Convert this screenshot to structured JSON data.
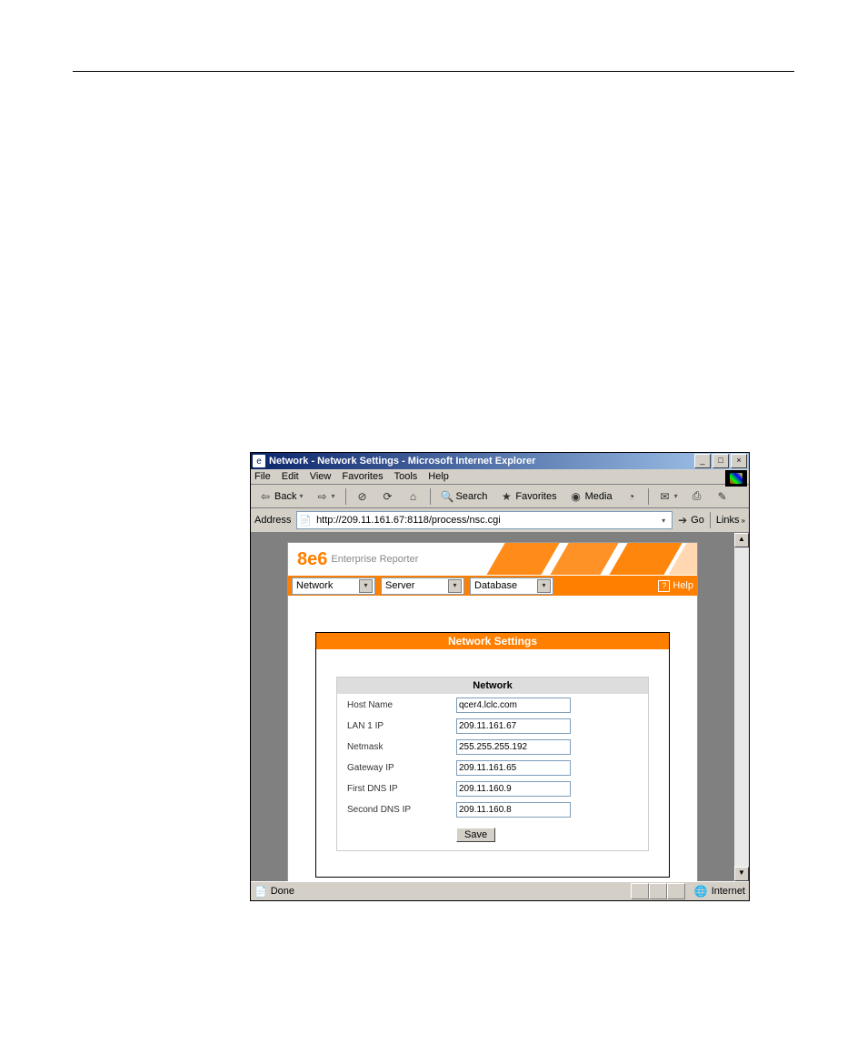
{
  "window": {
    "title": "Network - Network Settings - Microsoft Internet Explorer"
  },
  "menus": {
    "file": "File",
    "edit": "Edit",
    "view": "View",
    "favorites": "Favorites",
    "tools": "Tools",
    "help": "Help"
  },
  "toolbar": {
    "back": "Back",
    "search": "Search",
    "favorites": "Favorites",
    "media": "Media"
  },
  "address": {
    "label": "Address",
    "url": "http://209.11.161.67:8118/process/nsc.cgi",
    "go": "Go",
    "links": "Links"
  },
  "brand": {
    "logo": "8e6",
    "tagline": "Enterprise Reporter"
  },
  "nav": {
    "network": "Network",
    "server": "Server",
    "database": "Database",
    "help": "Help"
  },
  "panel": {
    "title": "Network Settings",
    "section": "Network",
    "labels": {
      "host": "Host Name",
      "lan1": "LAN 1 IP",
      "netmask": "Netmask",
      "gateway": "Gateway IP",
      "dns1": "First DNS IP",
      "dns2": "Second DNS IP"
    },
    "values": {
      "host": "qcer4.lclc.com",
      "lan1": "209.11.161.67",
      "netmask": "255.255.255.192",
      "gateway": "209.11.161.65",
      "dns1": "209.11.160.9",
      "dns2": "209.11.160.8"
    },
    "save": "Save"
  },
  "status": {
    "done": "Done",
    "zone": "Internet"
  }
}
